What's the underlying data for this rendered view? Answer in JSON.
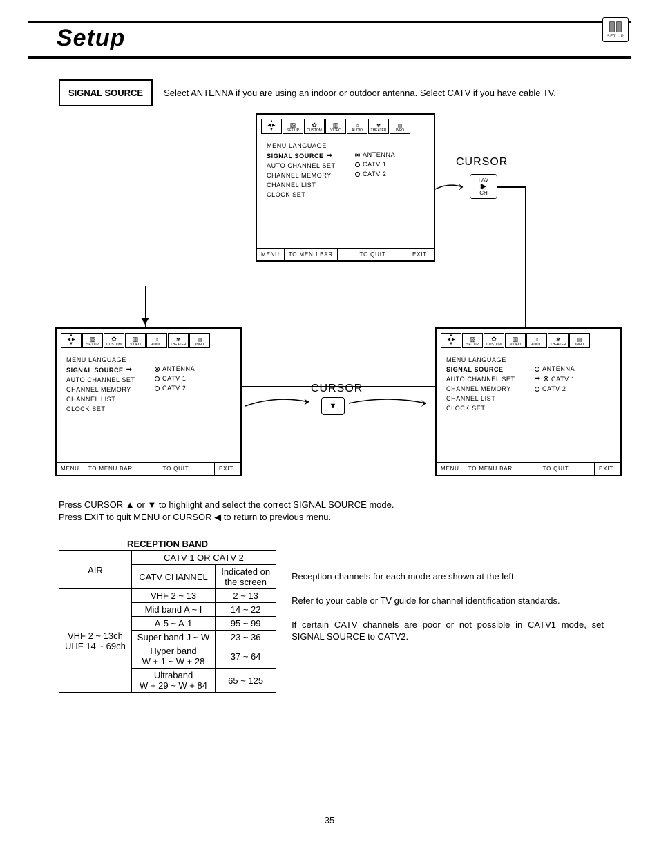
{
  "header": {
    "title": "Setup",
    "icon_label": "SET UP"
  },
  "section": {
    "label": "SIGNAL SOURCE",
    "desc": "Select ANTENNA if you are using an indoor or outdoor antenna.  Select CATV if you have cable TV."
  },
  "osd": {
    "tabs": [
      "SET UP",
      "CUSTOM",
      "VIDEO",
      "AUDIO",
      "THEATER",
      "INFO"
    ],
    "menu_items": [
      "MENU LANGUAGE",
      "SIGNAL SOURCE",
      "AUTO CHANNEL SET",
      "CHANNEL MEMORY",
      "CHANNEL LIST",
      "CLOCK SET"
    ],
    "options": [
      "ANTENNA",
      "CATV 1",
      "CATV 2"
    ],
    "footer": {
      "a": "MENU",
      "b": "TO MENU BAR",
      "c": "TO QUIT",
      "d": "EXIT"
    }
  },
  "cursor": {
    "label1": "CURSOR",
    "label2": "CURSOR",
    "remote": {
      "top": "FAV",
      "mid": "▶",
      "bot": "CH"
    },
    "down_glyph": "▼"
  },
  "instruction": {
    "line1": "Press CURSOR ▲ or ▼ to highlight and select the correct SIGNAL SOURCE mode.",
    "line2": "Press EXIT to quit MENU or CURSOR ◀ to return to previous menu."
  },
  "table": {
    "title": "RECEPTION BAND",
    "sub": "CATV 1 OR CATV 2",
    "air": "AIR",
    "catv_ch": "CATV CHANNEL",
    "ind_a": "Indicated on",
    "ind_b": "the screen",
    "air_rows": [
      "VHF 2 ~ 13ch",
      "UHF 14 ~ 69ch"
    ],
    "rows": [
      {
        "c": "VHF 2 ~ 13",
        "s": "2 ~ 13"
      },
      {
        "c": "Mid band A ~ I",
        "s": "14 ~ 22"
      },
      {
        "c": "A-5 ~ A-1",
        "s": "95 ~ 99"
      },
      {
        "c": "Super band J ~ W",
        "s": "23 ~ 36"
      },
      {
        "ca": "Hyper band",
        "cb": "W + 1 ~ W + 28",
        "s": "37 ~ 64"
      },
      {
        "ca": "Ultraband",
        "cb": "W + 29 ~ W + 84",
        "s": "65 ~ 125"
      }
    ]
  },
  "notes": {
    "p1": "Reception channels for each mode are shown at the left.",
    "p2": "Refer to your cable or TV guide for channel identification standards.",
    "p3": "If certain CATV channels are poor or not possible in CATV1 mode, set SIGNAL SOURCE to CATV2."
  },
  "page": "35"
}
